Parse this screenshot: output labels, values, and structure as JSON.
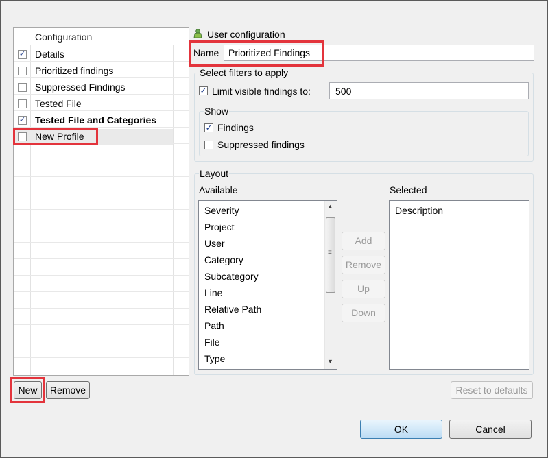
{
  "left": {
    "header": "Configuration",
    "rows": [
      {
        "label": "Details",
        "checked": true
      },
      {
        "label": "Prioritized findings",
        "checked": false
      },
      {
        "label": "Suppressed Findings",
        "checked": false
      },
      {
        "label": "Tested File",
        "checked": false
      },
      {
        "label": "Tested File and Categories",
        "checked": true
      },
      {
        "label": "New Profile",
        "checked": false
      }
    ],
    "new_label": "New",
    "remove_label": "Remove"
  },
  "right": {
    "title": "User configuration",
    "name_label": "Name",
    "name_value": "Prioritized Findings",
    "filters": {
      "title": "Select filters to apply",
      "limit_label": "Limit visible findings to:",
      "limit_checked": true,
      "limit_value": "500",
      "show_title": "Show",
      "findings_label": "Findings",
      "findings_checked": true,
      "suppressed_label": "Suppressed findings",
      "suppressed_checked": false
    },
    "layout": {
      "title": "Layout",
      "available_label": "Available",
      "selected_label": "Selected",
      "available": [
        "Severity",
        "Project",
        "User",
        "Category",
        "Subcategory",
        "Line",
        "Relative Path",
        "Path",
        "File",
        "Type"
      ],
      "selected": [
        "Description"
      ],
      "add_label": "Add",
      "remove_label": "Remove",
      "up_label": "Up",
      "down_label": "Down"
    },
    "reset_label": "Reset to defaults"
  },
  "footer": {
    "ok_label": "OK",
    "cancel_label": "Cancel"
  },
  "colors": {
    "highlight": "#e3343c",
    "ok_button": "#bcdcf4"
  }
}
